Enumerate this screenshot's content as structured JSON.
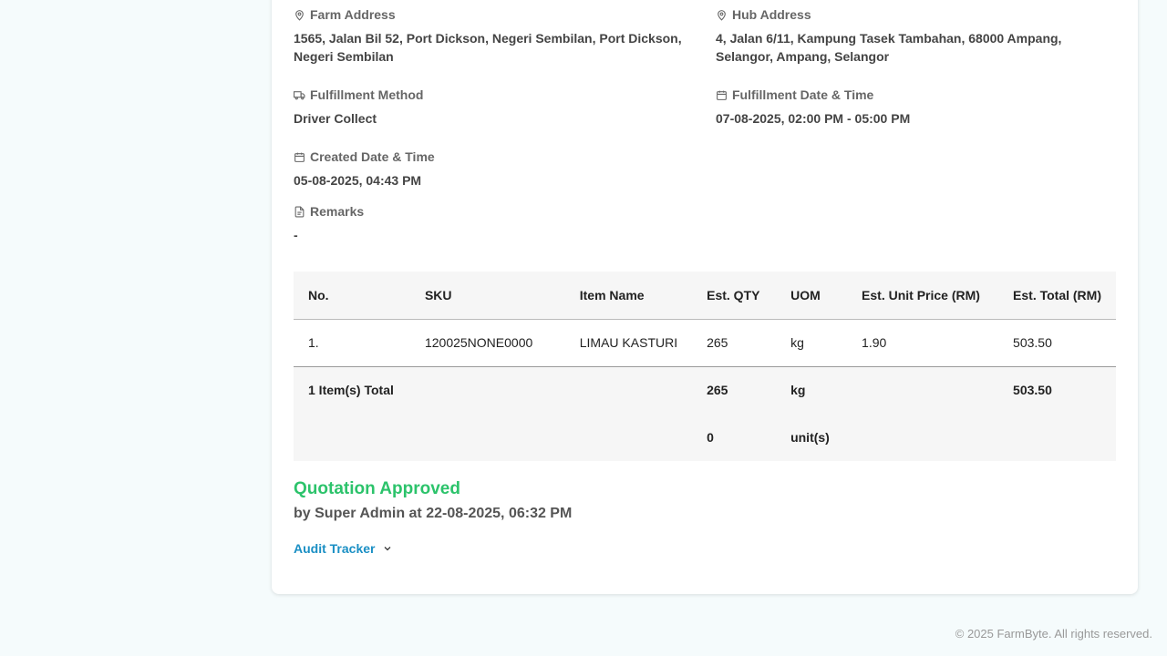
{
  "details": {
    "farm_address": {
      "label": "Farm Address",
      "value": "1565, Jalan Bil 52, Port Dickson, Negeri Sembilan, Port Dickson, Negeri Sembilan"
    },
    "hub_address": {
      "label": "Hub Address",
      "value": "4, Jalan 6/11, Kampung Tasek Tambahan, 68000 Ampang, Selangor, Ampang, Selangor"
    },
    "fulfillment_method": {
      "label": "Fulfillment Method",
      "value": "Driver Collect"
    },
    "fulfillment_datetime": {
      "label": "Fulfillment Date & Time",
      "value": "07-08-2025, 02:00 PM - 05:00 PM"
    },
    "created_datetime": {
      "label": "Created Date & Time",
      "value": "05-08-2025, 04:43 PM"
    },
    "remarks": {
      "label": "Remarks",
      "value": "-"
    }
  },
  "table": {
    "headers": [
      "No.",
      "SKU",
      "Item Name",
      "Est. QTY",
      "UOM",
      "Est. Unit Price (RM)",
      "Est. Total (RM)"
    ],
    "rows": [
      {
        "no": "1.",
        "sku": "120025NONE0000",
        "item_name": "LIMAU KASTURI",
        "qty": "265",
        "uom": "kg",
        "unit_price": "1.90",
        "total": "503.50"
      }
    ],
    "totals": {
      "label": "1 Item(s) Total",
      "qty_kg": "265",
      "uom_kg": "kg",
      "total": "503.50",
      "qty_unit": "0",
      "uom_unit": "unit(s)"
    }
  },
  "status": {
    "title": "Quotation Approved",
    "subtitle": "by Super Admin at 22-08-2025, 06:32 PM",
    "color": "#2cc36b"
  },
  "audit_tracker": {
    "label": "Audit Tracker"
  },
  "footer": {
    "copyright": "© 2025 FarmByte. All rights reserved."
  },
  "icons": {
    "farm_address": "map-pin-icon",
    "hub_address": "map-pin-icon",
    "fulfillment_method": "truck-icon",
    "fulfillment_datetime": "calendar-icon",
    "created_datetime": "calendar-icon",
    "remarks": "document-icon",
    "audit_tracker": "chevron-down-icon"
  }
}
